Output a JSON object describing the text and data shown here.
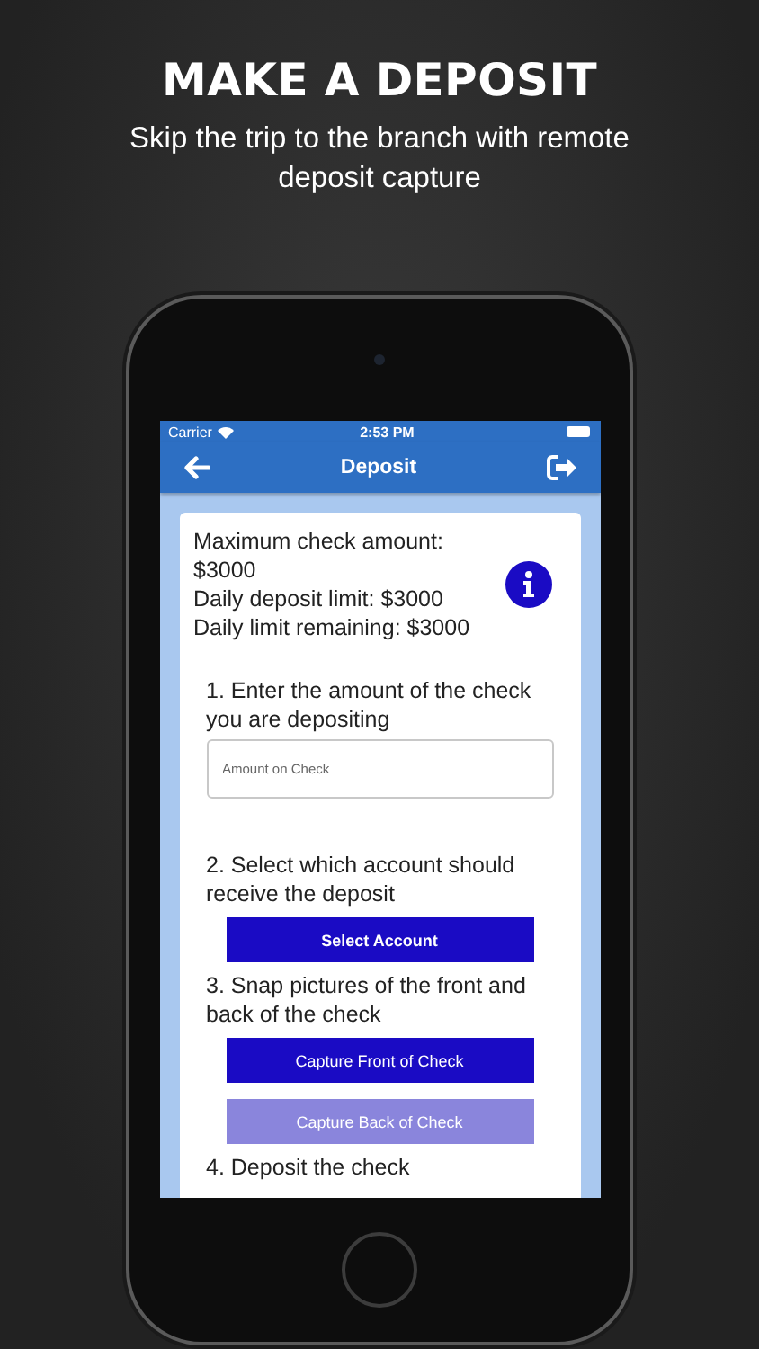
{
  "headline": "MAKE A DEPOSIT",
  "subtitle": "Skip the trip to the branch with remote deposit capture",
  "status_bar": {
    "carrier": "Carrier",
    "time": "2:53 PM"
  },
  "nav": {
    "title": "Deposit"
  },
  "limits": [
    "Maximum check amount: $3000",
    "Daily deposit limit: $3000",
    "Daily limit remaining: $3000"
  ],
  "steps": [
    {
      "text": "1. Enter the amount of the check you are depositing",
      "kind": "field",
      "placeholder": "Amount on Check"
    },
    {
      "text": "2. Select which account should receive the deposit",
      "kind": "buttons",
      "buttons": [
        {
          "label": "Select Account",
          "disabled": false
        }
      ]
    },
    {
      "text": "3. Snap pictures of the front and back of the check",
      "kind": "buttons",
      "buttons": [
        {
          "label": "Capture Front of Check",
          "disabled": false
        },
        {
          "label": "Capture Back of Check",
          "disabled": true
        }
      ]
    },
    {
      "text": "4. Deposit the check",
      "kind": "text"
    }
  ]
}
